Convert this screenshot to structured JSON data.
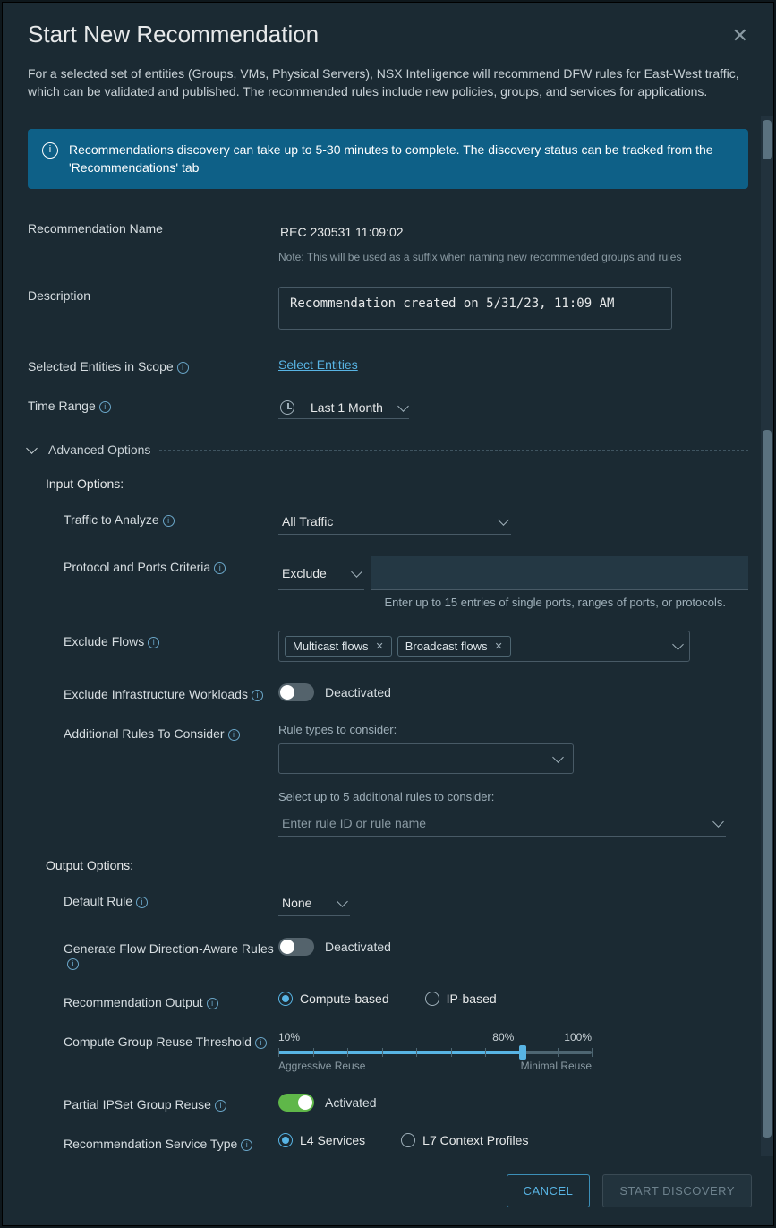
{
  "dialog": {
    "title": "Start New Recommendation",
    "intro": "For a selected set of entities (Groups, VMs, Physical Servers), NSX Intelligence will recommend DFW rules for East-West traffic, which can be validated and published. The recommended rules include new policies, groups, and services for applications.",
    "banner": "Recommendations discovery can take up to 5-30 minutes to complete. The discovery status can be tracked from the 'Recommendations' tab"
  },
  "labels": {
    "recName": "Recommendation Name",
    "description": "Description",
    "entities": "Selected Entities in Scope",
    "timeRange": "Time Range",
    "advanced": "Advanced Options",
    "inputOptions": "Input Options:",
    "traffic": "Traffic to Analyze",
    "protocol": "Protocol and Ports Criteria",
    "excludeFlows": "Exclude Flows",
    "excludeInfra": "Exclude Infrastructure Workloads",
    "additionalRules": "Additional Rules To Consider",
    "ruleTypes": "Rule types to consider:",
    "selectUpTo5": "Select up to 5 additional rules to consider:",
    "outputOptions": "Output Options:",
    "defaultRule": "Default Rule",
    "flowDir": "Generate Flow Direction-Aware Rules",
    "recOutput": "Recommendation Output",
    "computeThresh": "Compute Group Reuse Threshold",
    "partialIpset": "Partial IPSet Group Reuse",
    "recServiceType": "Recommendation Service Type"
  },
  "values": {
    "recName": "REC 230531 11:09:02",
    "recNote": "Note: This will be used as a suffix when naming new recommended groups and rules",
    "description": "Recommendation created on 5/31/23, 11:09 AM",
    "selectEntities": "Select Entities",
    "timeRange": "Last 1 Month",
    "traffic": "All Traffic",
    "protocolMode": "Exclude",
    "protocolHint": "Enter up to 15 entries of single ports, ranges of ports, or protocols.",
    "chip1": "Multicast flows",
    "chip2": "Broadcast flows",
    "deactivated": "Deactivated",
    "activated": "Activated",
    "rulePlaceholder": "Enter rule ID or rule name",
    "defaultRule": "None",
    "radioCompute": "Compute-based",
    "radioIp": "IP-based",
    "radioL4": "L4 Services",
    "radioL7": "L7 Context Profiles",
    "slider10": "10%",
    "slider80": "80%",
    "slider100": "100%",
    "sliderAgg": "Aggressive Reuse",
    "sliderMin": "Minimal Reuse"
  },
  "footer": {
    "cancel": "CANCEL",
    "start": "START DISCOVERY"
  }
}
